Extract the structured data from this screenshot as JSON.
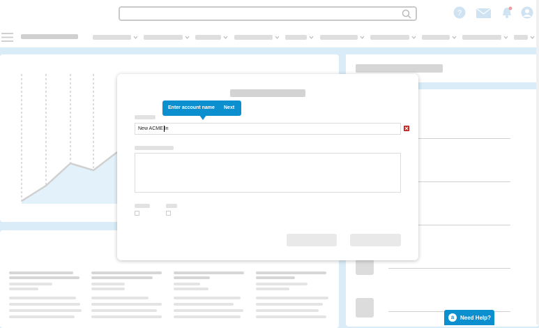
{
  "search": {
    "value": "",
    "placeholder": ""
  },
  "header": {
    "icons": [
      "help-icon",
      "mail-icon",
      "bell-icon",
      "avatar-icon"
    ]
  },
  "nav": {
    "items": [
      {
        "label": ""
      },
      {
        "label": ""
      },
      {
        "label": ""
      },
      {
        "label": ""
      },
      {
        "label": ""
      },
      {
        "label": ""
      },
      {
        "label": ""
      },
      {
        "label": ""
      },
      {
        "label": ""
      },
      {
        "label": ""
      }
    ]
  },
  "modal": {
    "account_field": {
      "value": "New ACME In"
    },
    "clear_icon": "close-icon",
    "description_field": {
      "value": ""
    }
  },
  "tooltip": {
    "text": "Enter account name",
    "next_label": "Next"
  },
  "help": {
    "label": "Need Help?"
  },
  "colors": {
    "accent": "#0b8fcf",
    "background": "#d9ecf8",
    "error": "#c62828"
  }
}
